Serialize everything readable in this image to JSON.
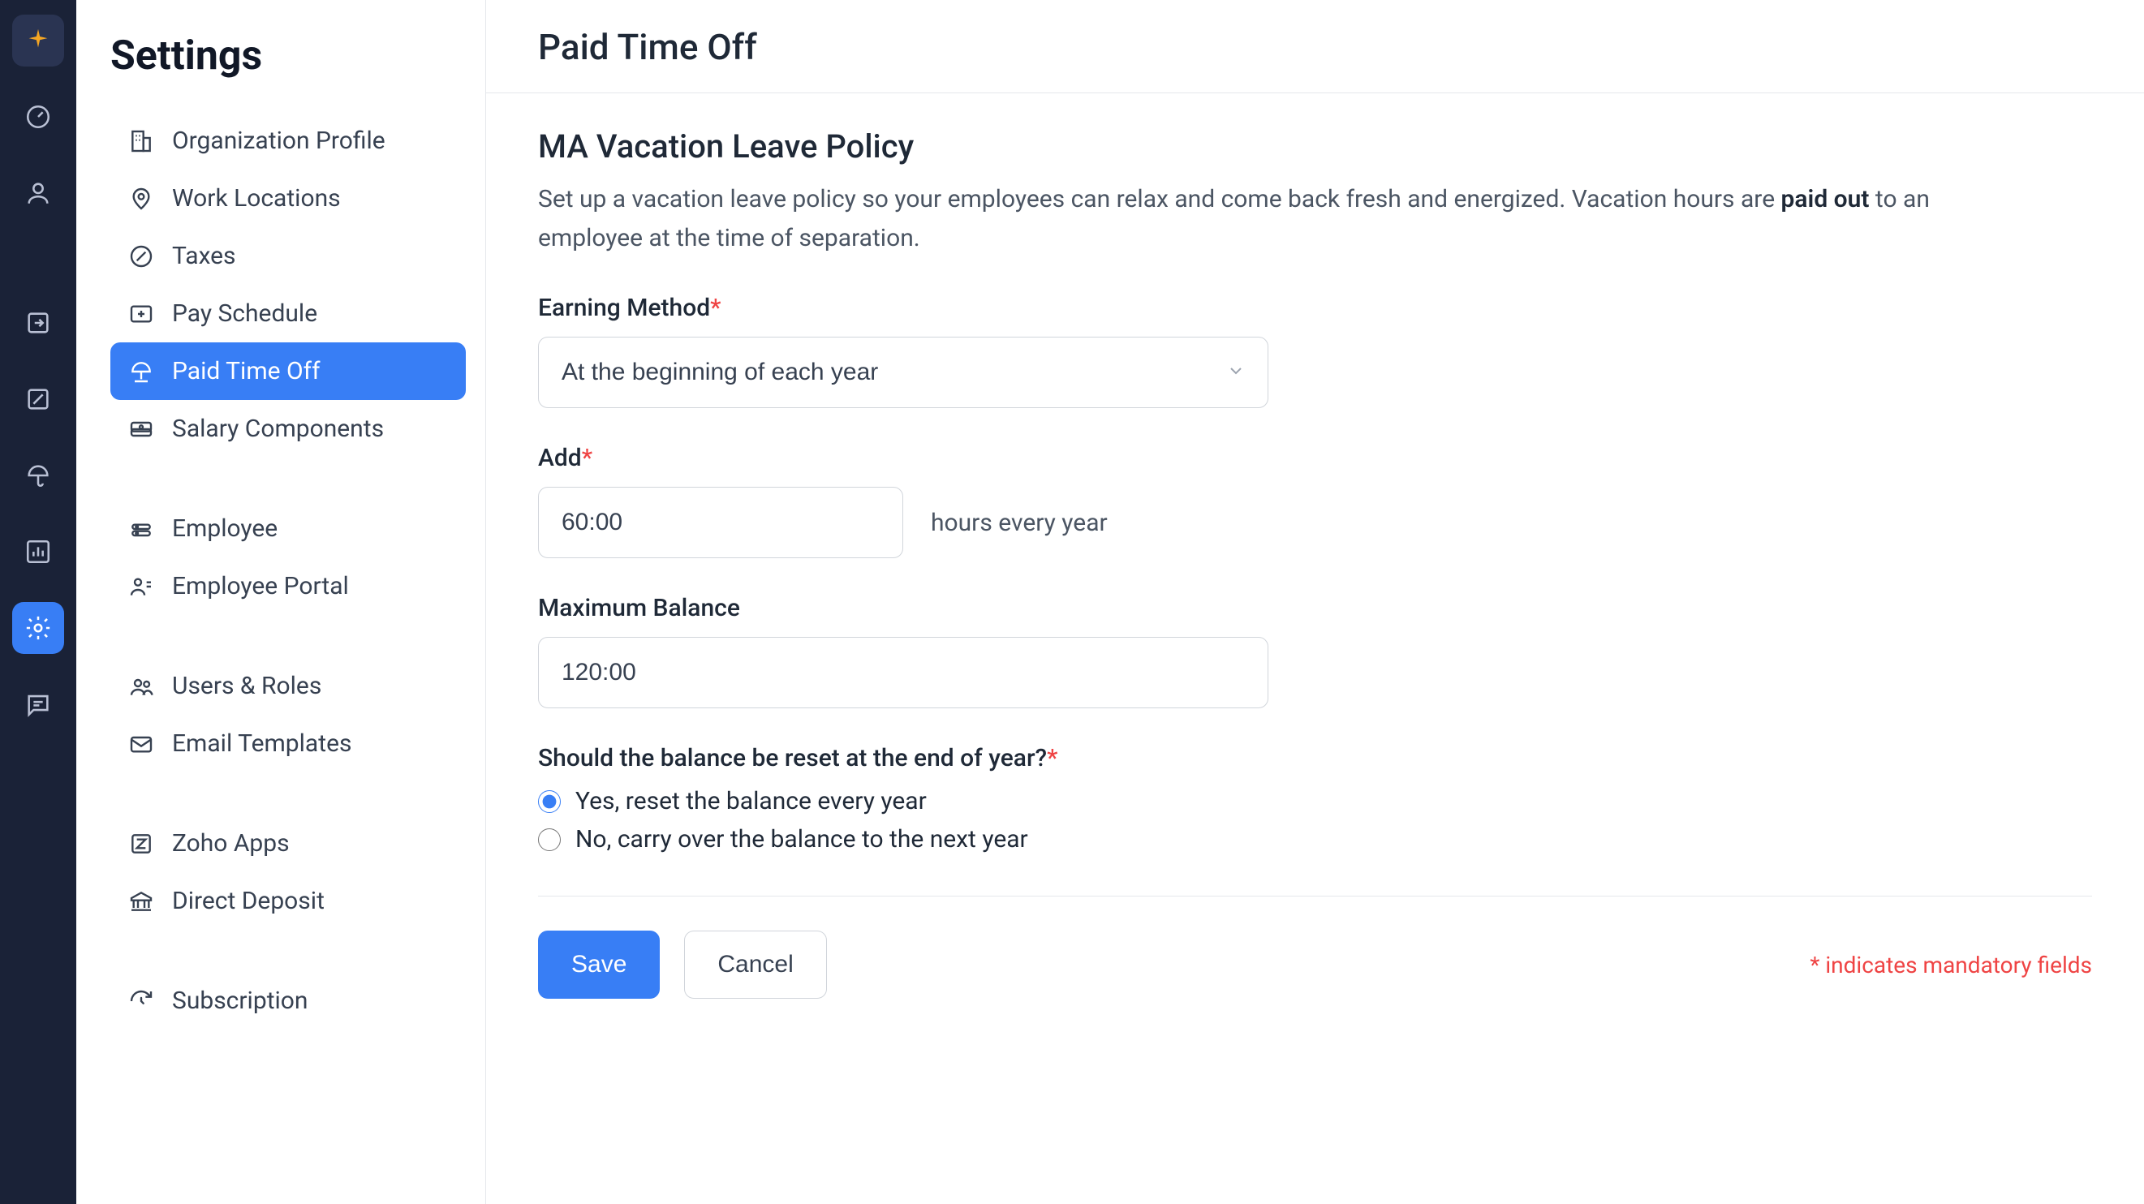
{
  "sidebar": {
    "title": "Settings",
    "nav_groups": [
      [
        "Organization Profile",
        "Work Locations",
        "Taxes",
        "Pay Schedule",
        "Paid Time Off",
        "Salary Components"
      ],
      [
        "Employee",
        "Employee Portal"
      ],
      [
        "Users & Roles",
        "Email Templates"
      ],
      [
        "Zoho Apps",
        "Direct Deposit"
      ],
      [
        "Subscription"
      ]
    ]
  },
  "page": {
    "title": "Paid Time Off",
    "section_title": "MA Vacation Leave Policy",
    "desc_1": "Set up a vacation leave policy so your employees can relax and come back fresh and energized. Vacation hours are ",
    "desc_bold": "paid out",
    "desc_2": " to an employee at the time of separation."
  },
  "form": {
    "earning_method": {
      "label": "Earning Method",
      "value": "At the beginning of each year"
    },
    "add": {
      "label": "Add",
      "value": "60:00",
      "suffix": "hours every year"
    },
    "max_balance": {
      "label": "Maximum Balance",
      "value": "120:00"
    },
    "reset": {
      "label": "Should the balance be reset at the end of year?",
      "option_yes": "Yes, reset the balance every year",
      "option_no": "No, carry over the balance to the next year"
    }
  },
  "actions": {
    "save": "Save",
    "cancel": "Cancel",
    "mandatory_note": "* indicates mandatory fields"
  }
}
